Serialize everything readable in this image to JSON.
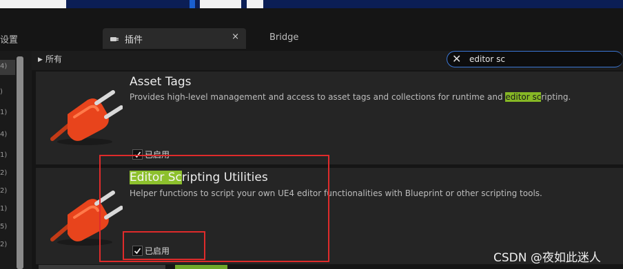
{
  "settings_tab": {
    "label": "设置"
  },
  "tabs": [
    {
      "label": "插件",
      "close": "×"
    },
    {
      "label": "Bridge"
    }
  ],
  "filter": {
    "arrow": "▶",
    "label": "所有"
  },
  "search": {
    "clear": "✕",
    "value": "editor sc"
  },
  "sidebar_counts": [
    "4)",
    ")",
    "1)",
    "4)",
    "1)",
    "2)",
    "2)",
    "1)",
    "5)",
    "2)"
  ],
  "plugins": [
    {
      "title": "Asset Tags",
      "description_pre": "Provides high-level management and access to asset tags and collections for runtime and ",
      "description_hl": "editor sc",
      "description_post": "ripting.",
      "enabled_label": "已启用"
    },
    {
      "title_hl": "Editor Sc",
      "title_rest": "ripting Utilities",
      "description": "Helper functions to script your own UE4 editor functionalities with Blueprint or other scripting tools.",
      "enabled_label": "已启用"
    }
  ],
  "watermark": "CSDN @夜如此迷人",
  "colors": {
    "highlight": "#86b825",
    "annotation": "#e02b2b",
    "search_border": "#3c78d8"
  },
  "icons": {
    "plugin": "plug-icon",
    "check": "check-icon",
    "clear": "close-icon"
  }
}
